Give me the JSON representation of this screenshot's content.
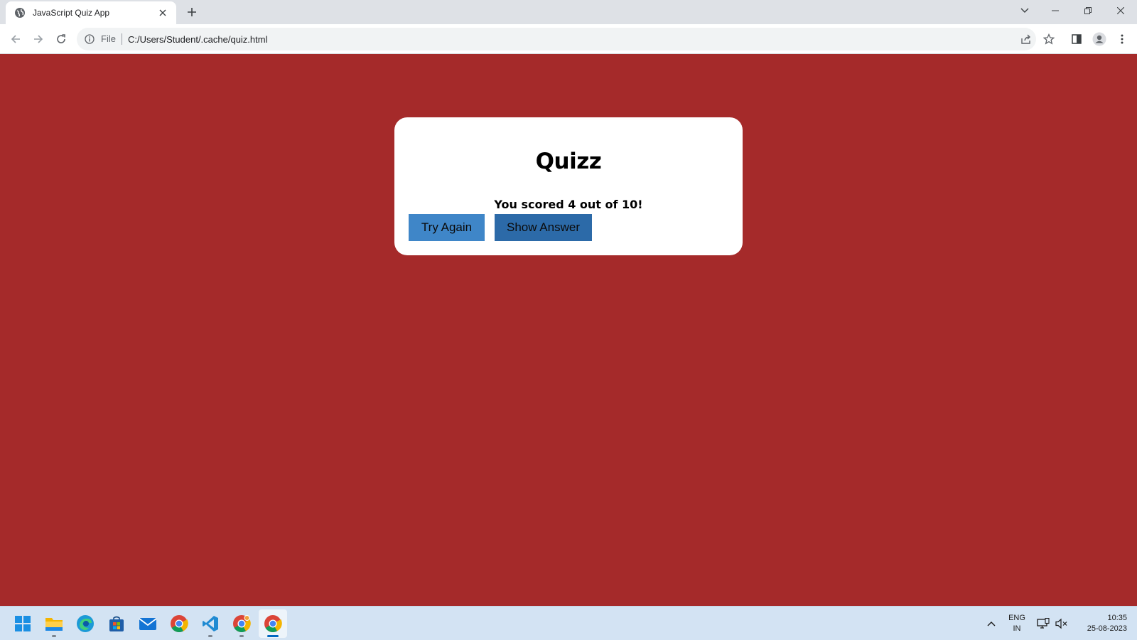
{
  "browser": {
    "tab_title": "JavaScript Quiz App",
    "url_scheme": "File",
    "url": "C:/Users/Student/.cache/quiz.html"
  },
  "quiz": {
    "title": "Quizz",
    "score_text": "You scored 4 out of 10!",
    "try_again_label": "Try Again",
    "show_answer_label": "Show Answer",
    "score": 4,
    "total": 10
  },
  "taskbar": {
    "apps": [
      "start-icon",
      "file-explorer-icon",
      "edge-icon",
      "store-icon",
      "mail-icon",
      "chrome-icon",
      "vscode-icon",
      "chrome-canary-icon",
      "chrome-active-icon"
    ],
    "language_line1": "ENG",
    "language_line2": "IN",
    "time": "10:35",
    "date": "25-08-2023"
  },
  "colors": {
    "page_background": "#a52a2a",
    "card_background": "#ffffff",
    "try_again_bg": "#3f86c8",
    "show_answer_bg": "#2c6aa8"
  }
}
